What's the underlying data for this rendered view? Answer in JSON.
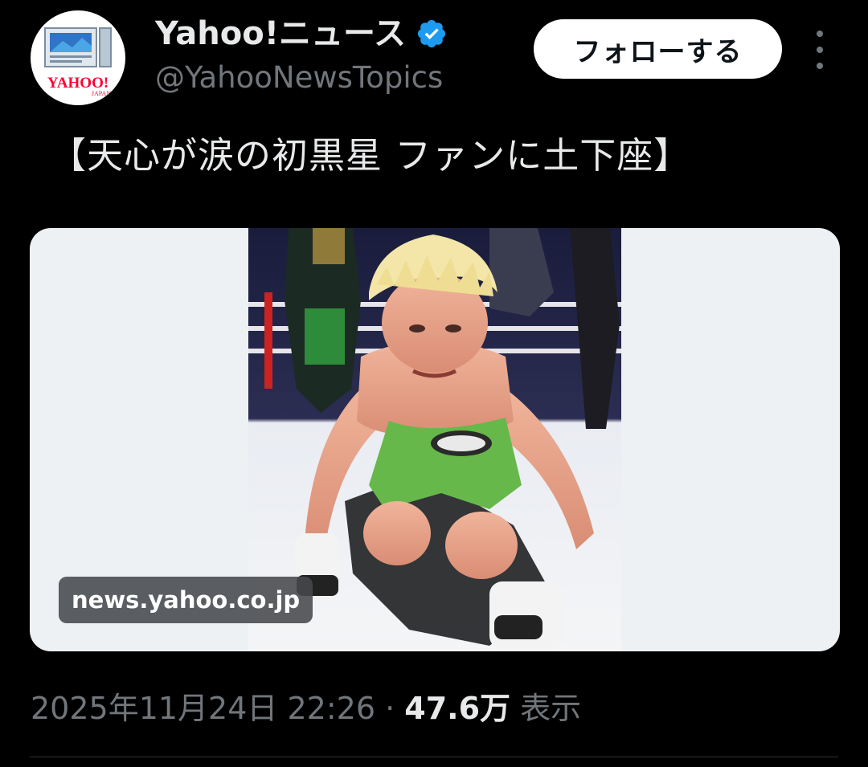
{
  "account": {
    "display_name": "Yahoo!ニュース",
    "handle": "@YahooNewsTopics",
    "avatar_logo_text": "YAHOO!",
    "avatar_logo_sub": "JAPAN"
  },
  "follow_button_label": "フォローする",
  "tweet": {
    "text": "【天心が涙の初黒星 ファンに土下座】",
    "link_domain": "news.yahoo.co.jp",
    "date": "2025年11月24日 22:26",
    "separator": "·",
    "views_count": "47.6万",
    "views_label": "表示"
  },
  "colors": {
    "background": "#000000",
    "text_primary": "#e7e9ea",
    "text_secondary": "#71767b",
    "verified_badge": "#1d9bf0",
    "follow_button_bg": "#ffffff",
    "yahoo_red": "#ff0033"
  }
}
